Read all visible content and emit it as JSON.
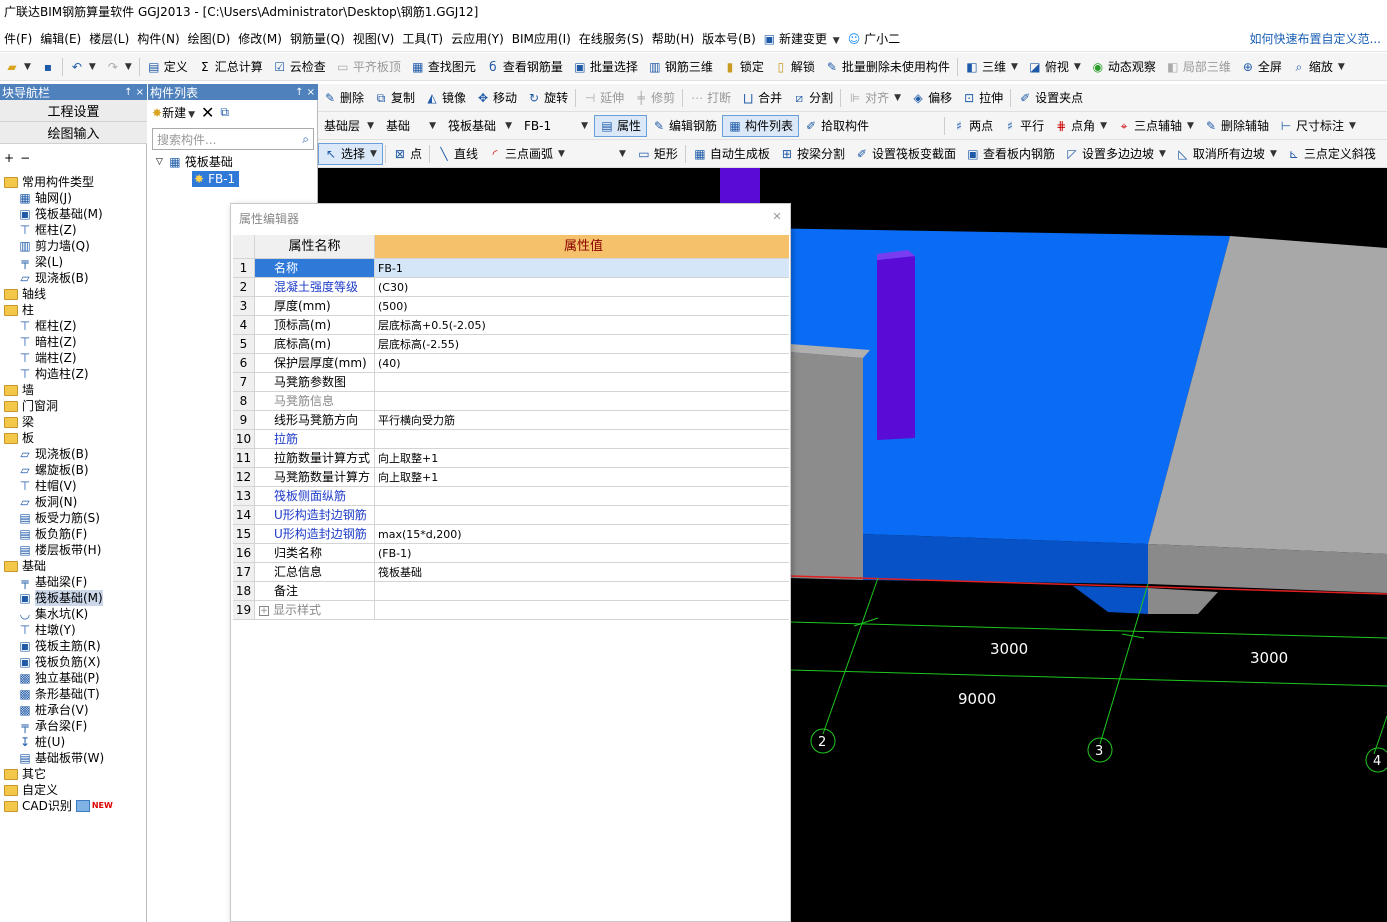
{
  "title": "广联达BIM钢筋算量软件 GGJ2013 - [C:\\Users\\Administrator\\Desktop\\钢筋1.GGJ12]",
  "menu": {
    "items": [
      "件(F)",
      "编辑(E)",
      "楼层(L)",
      "构件(N)",
      "绘图(D)",
      "修改(M)",
      "钢筋量(Q)",
      "视图(V)",
      "工具(T)",
      "云应用(Y)",
      "BIM应用(I)",
      "在线服务(S)",
      "帮助(H)",
      "版本号(B)",
      "新建变更",
      "广小二"
    ],
    "tip": "如何快速布置自定义范..."
  },
  "toolbar1": {
    "items": [
      "定义",
      "汇总计算",
      "云检查",
      "平齐板顶",
      "查找图元",
      "查看钢筋量",
      "批量选择",
      "钢筋三维",
      "锁定",
      "解锁",
      "批量删除未使用构件",
      "三维",
      "俯视",
      "动态观察",
      "局部三维",
      "全屏",
      "缩放"
    ]
  },
  "toolbar2": {
    "items": [
      "删除",
      "复制",
      "镜像",
      "移动",
      "旋转",
      "延伸",
      "修剪",
      "打断",
      "合并",
      "分割",
      "对齐",
      "偏移",
      "拉伸",
      "设置夹点"
    ]
  },
  "toolbar3": {
    "combos": [
      "基础层",
      "基础",
      "筏板基础",
      "FB-1"
    ],
    "items": [
      "属性",
      "编辑钢筋",
      "构件列表",
      "拾取构件",
      "两点",
      "平行",
      "点角",
      "三点辅轴",
      "删除辅轴",
      "尺寸标注"
    ]
  },
  "toolbar4": {
    "items": [
      "选择",
      "点",
      "直线",
      "三点画弧",
      "矩形",
      "自动生成板",
      "按梁分割",
      "设置筏板变截面",
      "查看板内钢筋",
      "设置多边边坡",
      "取消所有边坡",
      "三点定义斜筏"
    ]
  },
  "nav": {
    "header": "块导航栏",
    "pin": "↑ ×",
    "btn_project": "工程设置",
    "btn_draw": "绘图输入",
    "tree": [
      {
        "label": "常用构件类型",
        "level": 0,
        "type": "folder"
      },
      {
        "label": "轴网(J)",
        "level": 1,
        "icon": "grid-icon"
      },
      {
        "label": "筏板基础(M)",
        "level": 1,
        "icon": "raft-icon"
      },
      {
        "label": "框柱(Z)",
        "level": 1,
        "icon": "column-icon"
      },
      {
        "label": "剪力墙(Q)",
        "level": 1,
        "icon": "wall-icon"
      },
      {
        "label": "梁(L)",
        "level": 1,
        "icon": "beam-icon"
      },
      {
        "label": "现浇板(B)",
        "level": 1,
        "icon": "slab-icon"
      },
      {
        "label": "轴线",
        "level": 0,
        "type": "folder"
      },
      {
        "label": "柱",
        "level": 0,
        "type": "folder"
      },
      {
        "label": "框柱(Z)",
        "level": 1,
        "icon": "column-icon"
      },
      {
        "label": "暗柱(Z)",
        "level": 1,
        "icon": "column-icon"
      },
      {
        "label": "端柱(Z)",
        "level": 1,
        "icon": "column-icon"
      },
      {
        "label": "构造柱(Z)",
        "level": 1,
        "icon": "column-icon"
      },
      {
        "label": "墙",
        "level": 0,
        "type": "folder"
      },
      {
        "label": "门窗洞",
        "level": 0,
        "type": "folder"
      },
      {
        "label": "梁",
        "level": 0,
        "type": "folder"
      },
      {
        "label": "板",
        "level": 0,
        "type": "folder"
      },
      {
        "label": "现浇板(B)",
        "level": 1,
        "icon": "slab-icon"
      },
      {
        "label": "螺旋板(B)",
        "level": 1,
        "icon": "slab-icon"
      },
      {
        "label": "柱帽(V)",
        "level": 1,
        "icon": "column-icon"
      },
      {
        "label": "板洞(N)",
        "level": 1,
        "icon": "slab-icon"
      },
      {
        "label": "板受力筋(S)",
        "level": 1,
        "icon": "rebar-icon"
      },
      {
        "label": "板负筋(F)",
        "level": 1,
        "icon": "rebar-icon"
      },
      {
        "label": "楼层板带(H)",
        "level": 1,
        "icon": "rebar-icon"
      },
      {
        "label": "基础",
        "level": 0,
        "type": "folder"
      },
      {
        "label": "基础梁(F)",
        "level": 1,
        "icon": "beam-icon"
      },
      {
        "label": "筏板基础(M)",
        "level": 1,
        "icon": "raft-icon",
        "selected": true
      },
      {
        "label": "集水坑(K)",
        "level": 1,
        "icon": "pit-icon"
      },
      {
        "label": "柱墩(Y)",
        "level": 1,
        "icon": "column-icon"
      },
      {
        "label": "筏板主筋(R)",
        "level": 1,
        "icon": "raft-icon"
      },
      {
        "label": "筏板负筋(X)",
        "level": 1,
        "icon": "raft-icon"
      },
      {
        "label": "独立基础(P)",
        "level": 1,
        "icon": "footing-icon"
      },
      {
        "label": "条形基础(T)",
        "level": 1,
        "icon": "footing-icon"
      },
      {
        "label": "桩承台(V)",
        "level": 1,
        "icon": "footing-icon"
      },
      {
        "label": "承台梁(F)",
        "level": 1,
        "icon": "beam-icon"
      },
      {
        "label": "桩(U)",
        "level": 1,
        "icon": "pile-icon"
      },
      {
        "label": "基础板带(W)",
        "level": 1,
        "icon": "rebar-icon"
      },
      {
        "label": "其它",
        "level": 0,
        "type": "folder"
      },
      {
        "label": "自定义",
        "level": 0,
        "type": "folder"
      },
      {
        "label": "CAD识别",
        "level": 0,
        "type": "folder",
        "badge": "NEW"
      }
    ]
  },
  "complist": {
    "header": "构件列表",
    "pin": "↑ ×",
    "new_label": "新建",
    "search_placeholder": "搜索构件...",
    "tree_root": "筏板基础",
    "tree_child": "FB-1"
  },
  "propeditor": {
    "title": "属性编辑器",
    "col_name": "属性名称",
    "col_value": "属性值",
    "rows": [
      {
        "n": "1",
        "name": "名称",
        "value": "FB-1",
        "style": "sel"
      },
      {
        "n": "2",
        "name": "混凝土强度等级",
        "value": "(C30)",
        "style": "blue"
      },
      {
        "n": "3",
        "name": "厚度(mm)",
        "value": "(500)",
        "style": ""
      },
      {
        "n": "4",
        "name": "顶标高(m)",
        "value": "层底标高+0.5(-2.05)",
        "style": ""
      },
      {
        "n": "5",
        "name": "底标高(m)",
        "value": "层底标高(-2.55)",
        "style": ""
      },
      {
        "n": "6",
        "name": "保护层厚度(mm)",
        "value": "(40)",
        "style": ""
      },
      {
        "n": "7",
        "name": "马凳筋参数图",
        "value": "",
        "style": ""
      },
      {
        "n": "8",
        "name": "马凳筋信息",
        "value": "",
        "style": "gray"
      },
      {
        "n": "9",
        "name": "线形马凳筋方向",
        "value": "平行横向受力筋",
        "style": ""
      },
      {
        "n": "10",
        "name": "拉筋",
        "value": "",
        "style": "blue"
      },
      {
        "n": "11",
        "name": "拉筋数量计算方式",
        "value": "向上取整+1",
        "style": ""
      },
      {
        "n": "12",
        "name": "马凳筋数量计算方",
        "value": "向上取整+1",
        "style": ""
      },
      {
        "n": "13",
        "name": "筏板侧面纵筋",
        "value": "",
        "style": "blue"
      },
      {
        "n": "14",
        "name": "U形构造封边钢筋",
        "value": "",
        "style": "blue"
      },
      {
        "n": "15",
        "name": "U形构造封边钢筋",
        "value": "max(15*d,200)",
        "style": "blue"
      },
      {
        "n": "16",
        "name": "归类名称",
        "value": "(FB-1)",
        "style": ""
      },
      {
        "n": "17",
        "name": "汇总信息",
        "value": "筏板基础",
        "style": ""
      },
      {
        "n": "18",
        "name": "备注",
        "value": "",
        "style": ""
      },
      {
        "n": "19",
        "name": "显示样式",
        "value": "",
        "style": "gray",
        "expander": "+"
      }
    ]
  },
  "viewport": {
    "dims": [
      "3000",
      "3000",
      "9000"
    ],
    "axes": [
      "2",
      "3",
      "4"
    ]
  },
  "colors": {
    "raft": "#0a6cf5",
    "raft_side": "#0752c7",
    "column": "#5a0cd6",
    "wall": "#999999",
    "axis": "#1ec81e",
    "nav_header": "#4f81bd"
  }
}
